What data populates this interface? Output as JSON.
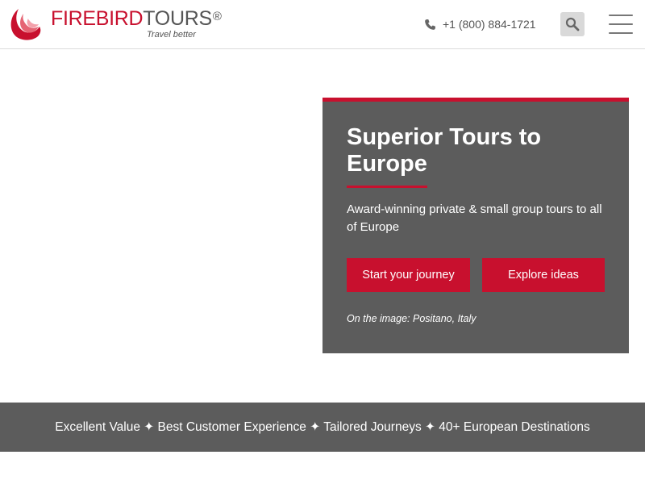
{
  "header": {
    "logo": {
      "brand_first": "FIREBIRD",
      "brand_second": "TOURS",
      "registered_mark": "®",
      "tagline": "Travel better",
      "brand_color": "#c8102e"
    },
    "phone": {
      "icon": "phone-icon",
      "number": "+1 (800) 884-1721"
    },
    "search": {
      "icon": "search-icon"
    },
    "menu": {
      "icon": "hamburger-menu-icon"
    }
  },
  "hero": {
    "title": "Superior Tours to Europe",
    "subtitle": "Award-winning private & small group tours to all of Europe",
    "primary_button": "Start your journey",
    "secondary_button": "Explore ideas",
    "image_caption": "On the image: Positano, Italy",
    "panel_color": "#5c5c5c",
    "accent_color": "#c8102e"
  },
  "value_bar": {
    "text": "Excellent Value ✦ Best Customer Experience ✦ Tailored Journeys ✦ 40+ European Destinations"
  }
}
